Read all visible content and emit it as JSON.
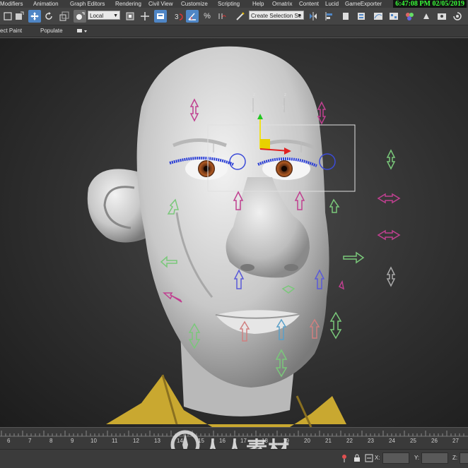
{
  "menu": {
    "items": [
      "Modifiers",
      "Animation",
      "Graph Editors",
      "Rendering",
      "Civil View",
      "Customize",
      "Scripting",
      "Help",
      "Ornatrix",
      "Content",
      "Lucid",
      "GameExporter"
    ]
  },
  "clock": "6:47:08 PM 02/05/2019",
  "toolbar": {
    "coord_system": "Local",
    "selection_set": "Create Selection Se",
    "snap_angle_label": "3",
    "percent_label": "%"
  },
  "ribbon": {
    "object_paint": "ect Paint",
    "populate": "Populate"
  },
  "timeline": {
    "ticks": [
      "6",
      "7",
      "8",
      "9",
      "10",
      "11",
      "12",
      "13",
      "14",
      "15",
      "16",
      "17",
      "18",
      "19",
      "20",
      "21",
      "22",
      "23",
      "24",
      "25",
      "26",
      "27"
    ]
  },
  "status": {
    "x_label": "X:",
    "y_label": "Y:",
    "z_label": "Z:"
  },
  "watermark": {
    "text": "人人素材",
    "color": "#ffffff"
  },
  "colors": {
    "active_tool": "#4f86c6",
    "clock_text": "#39ff39",
    "shirt": "#c9a830",
    "skin": "#d9d9d9",
    "eyelash": "#2b3fd6",
    "selection_box": "#e0e0e0"
  }
}
